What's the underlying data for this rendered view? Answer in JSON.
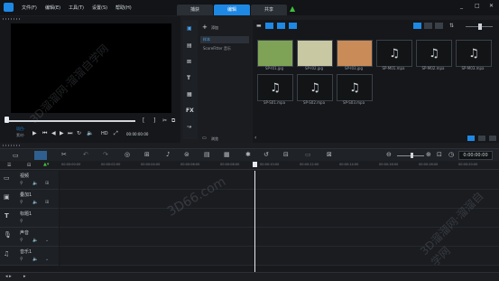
{
  "menu": [
    "文件(F)",
    "编辑(E)",
    "工具(T)",
    "设置(S)",
    "帮助(H)"
  ],
  "mode_tabs": [
    "捕获",
    "编辑",
    "共享"
  ],
  "window_controls": [
    "_",
    "□",
    "✕"
  ],
  "player": {
    "mode_project": "项目-",
    "mode_clip": "素材-",
    "hd": "HD",
    "timecode": "00:00:00:00"
  },
  "library": {
    "add_label": "添加",
    "folders": [
      "样本",
      "ScoreFitter 音乐"
    ],
    "browse_label": "浏览"
  },
  "media": [
    {
      "name": "SP-I01.jpg",
      "type": "image",
      "color": "#7fa356"
    },
    {
      "name": "SP-I02.jpg",
      "type": "image",
      "color": "#c8c8a2"
    },
    {
      "name": "SP-I03.jpg",
      "type": "image",
      "color": "#c98b57"
    },
    {
      "name": "SP-M01.mpa",
      "type": "audio"
    },
    {
      "name": "SP-M02.mpa",
      "type": "audio"
    },
    {
      "name": "SP-M03.mpa",
      "type": "audio"
    },
    {
      "name": "SP-S01.mpa",
      "type": "audio"
    },
    {
      "name": "SP-S02.mpa",
      "type": "audio"
    },
    {
      "name": "SP-S03.mpa",
      "type": "audio"
    }
  ],
  "timeline": {
    "ruler": [
      "00:00:00:00",
      "00:00:02:00",
      "00:00:04:00",
      "00:00:06:00",
      "00:00:08:00",
      "00:00:10:00",
      "00:00:12:00",
      "00:00:14:00",
      "00:00:16:00",
      "00:00:18:00",
      "00:00:20:00"
    ],
    "timecode": "0:00:00:00",
    "tracks": [
      "视频",
      "叠加1",
      "标题1",
      "声音",
      "音乐1"
    ]
  },
  "watermarks": [
    "3D溜溜网·溜溜自学网",
    "3D66.com",
    "3D溜溜网·溜溜自学网"
  ],
  "colors": {
    "accent": "#1e88e5",
    "bg": "#1b1d21",
    "panel": "#15171a"
  }
}
